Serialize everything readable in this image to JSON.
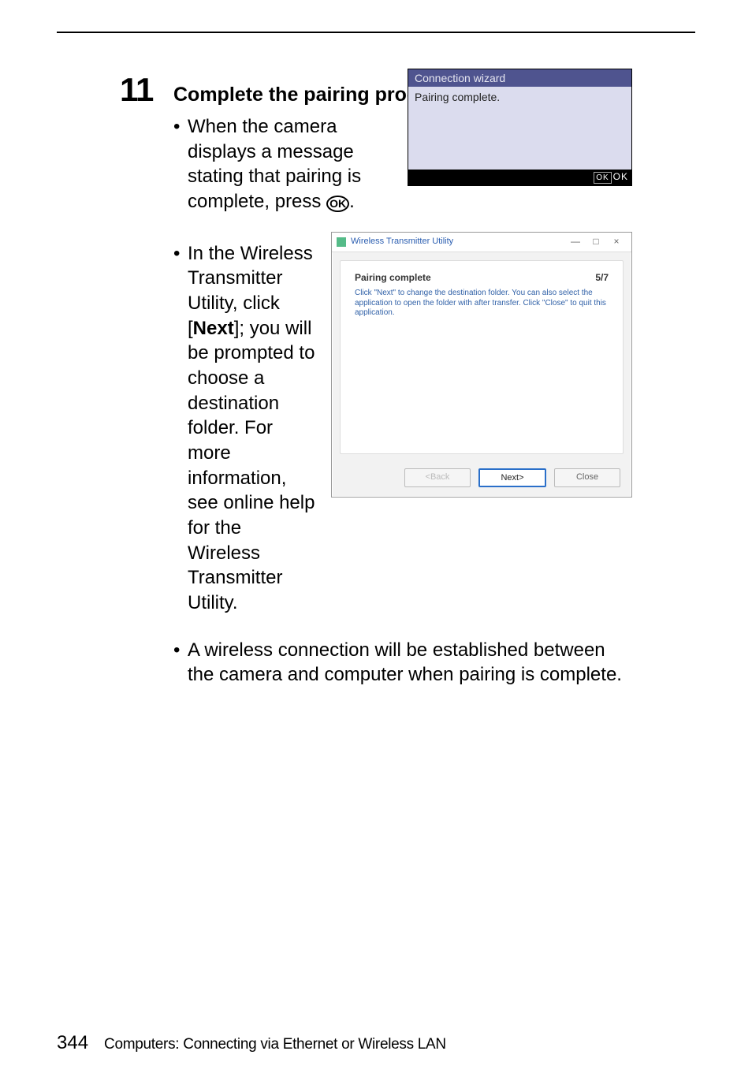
{
  "step": {
    "number": "11",
    "title": "Complete the pairing process.",
    "bullets": [
      {
        "pre": "When the camera displays a message stating that pairing is complete, press ",
        "post": "."
      },
      {
        "pre1": "In the Wireless Transmitter Utility, click [",
        "bold": "Next",
        "post1": "]; you will be prompted to choose a destination folder. For more information, see online help for the Wireless Transmitter Utility."
      },
      {
        "text": "A wireless connection will be established between the camera and computer when pairing is complete."
      }
    ]
  },
  "camera_lcd": {
    "title": "Connection wizard",
    "body": "Pairing complete.",
    "footer_btn": "OK",
    "footer_text": "OK"
  },
  "dialog": {
    "title": "Wireless Transmitter Utility",
    "window_buttons": {
      "min": "—",
      "max": "□",
      "close": "×"
    },
    "step_indicator": "5/7",
    "heading": "Pairing complete",
    "paragraph": "Click \"Next\" to change the destination folder. You can also select the application to open the folder with after transfer. Click \"Close\" to quit this application.",
    "buttons": {
      "back": "<Back",
      "next": "Next>",
      "close": "Close"
    }
  },
  "footer": {
    "page": "344",
    "section": "Computers: Connecting via Ethernet or Wireless LAN"
  }
}
